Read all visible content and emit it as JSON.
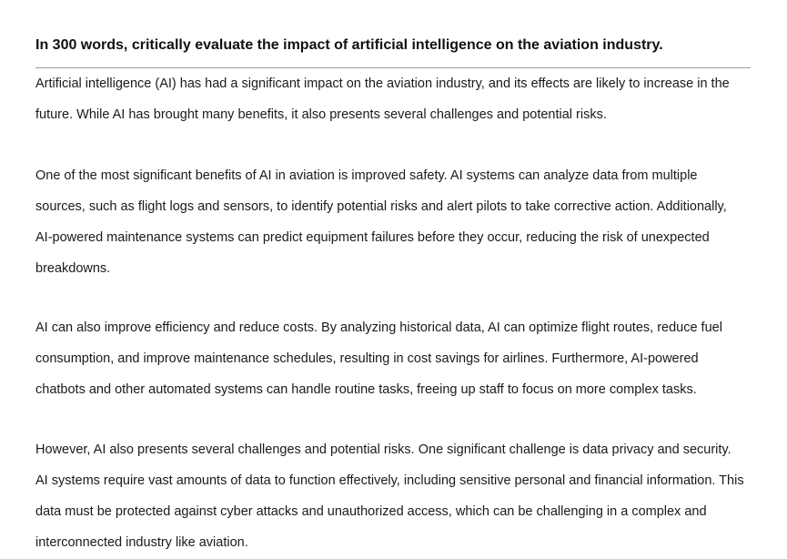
{
  "document": {
    "title": "In 300 words, critically evaluate the impact of artificial intelligence on the aviation industry.",
    "paragraphs": [
      {
        "lines": [
          "Artificial intelligence (AI) has had a significant impact on the aviation industry, and its effects are likely to increase in the",
          "future. While AI has brought many benefits, it also presents several challenges and potential risks."
        ]
      },
      {
        "lines": [
          "One of the most significant benefits of AI in aviation is improved safety. AI systems can analyze data from multiple",
          "sources, such as flight logs and sensors, to identify potential risks and alert pilots to take corrective action. Additionally,",
          "AI-powered maintenance systems can predict equipment failures before they occur, reducing the risk of unexpected",
          "breakdowns."
        ]
      },
      {
        "lines": [
          "AI can also improve efficiency and reduce costs. By analyzing historical data, AI can optimize flight routes, reduce fuel",
          "consumption, and improve maintenance schedules, resulting in cost savings for airlines. Furthermore, AI-powered",
          "chatbots and other automated systems can handle routine tasks, freeing up staff to focus on more complex tasks."
        ]
      },
      {
        "lines": [
          "However, AI also presents several challenges and potential risks. One significant challenge is data privacy and security.",
          "AI systems require vast amounts of data to function effectively, including sensitive personal and financial information. This",
          "data must be protected against cyber attacks and unauthorized access, which can be challenging in a complex and",
          "interconnected industry like aviation."
        ]
      }
    ]
  }
}
